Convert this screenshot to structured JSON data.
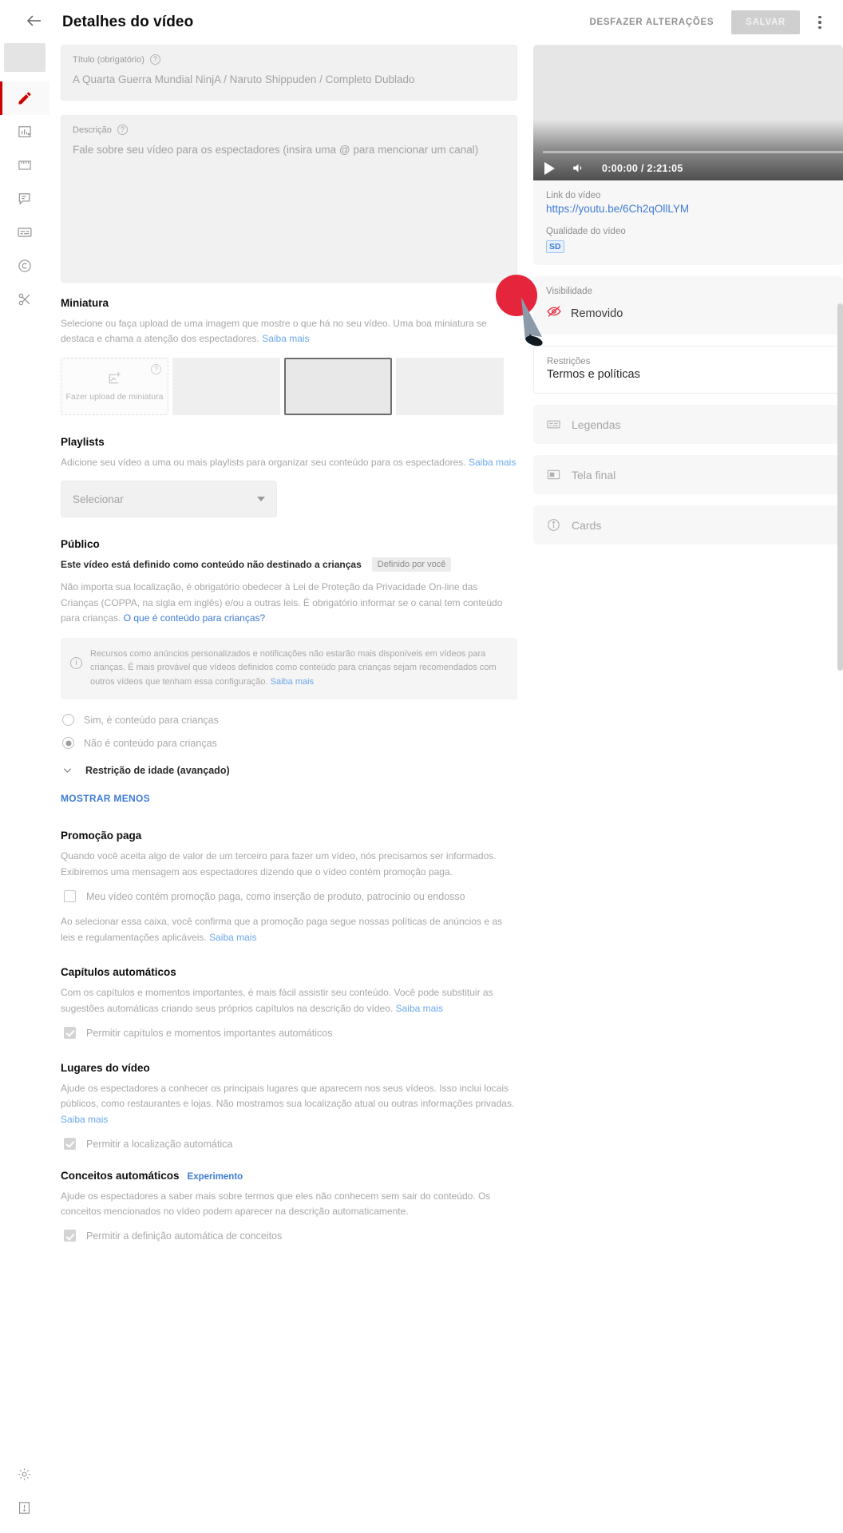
{
  "header": {
    "back_icon": "arrow-left-icon",
    "title": "Detalhes do vídeo",
    "undo_label": "DESFAZER ALTERAÇÕES",
    "save_label": "SALVAR",
    "menu_icon": "kebab-menu-icon"
  },
  "sidebar": {
    "items": [
      {
        "icon": "pencil-icon",
        "name": "details",
        "active": true
      },
      {
        "icon": "analytics-bar-chart-icon",
        "name": "analytics",
        "active": false
      },
      {
        "icon": "filmstrip-editor-icon",
        "name": "editor",
        "active": false
      },
      {
        "icon": "comment-icon",
        "name": "comments",
        "active": false
      },
      {
        "icon": "subtitles-icon",
        "name": "subtitles",
        "active": false
      },
      {
        "icon": "copyright-icon",
        "name": "copyright",
        "active": false
      },
      {
        "icon": "scissors-icon",
        "name": "trim",
        "active": false
      }
    ],
    "bottom_items": [
      {
        "icon": "gear-icon",
        "name": "settings"
      },
      {
        "icon": "feedback-icon",
        "name": "send-feedback"
      }
    ]
  },
  "main": {
    "title_field": {
      "label": "Título (obrigatório)",
      "help": "?",
      "value": "A Quarta Guerra Mundial NinjA / Naruto Shippuden / Completo Dublado"
    },
    "description_field": {
      "label": "Descrição",
      "help": "?",
      "placeholder": "Fale sobre seu vídeo para os espectadores (insira uma @ para mencionar um canal)"
    },
    "thumbnail": {
      "heading": "Miniatura",
      "description": "Selecione ou faça upload de uma imagem que mostre o que há no seu vídeo. Uma boa miniatura se destaca e chama a atenção dos espectadores.",
      "learn_more": "Saiba mais",
      "upload_label": "Fazer upload de miniatura",
      "upload_icon": "image-upload-icon",
      "help": "?",
      "options_count": 3,
      "selected_index": 2
    },
    "playlists": {
      "heading": "Playlists",
      "description": "Adicione seu vídeo a uma ou mais playlists para organizar seu conteúdo para os espectadores.",
      "learn_more": "Saiba mais",
      "select_value": "Selecionar",
      "caret_icon": "chevron-down-icon"
    },
    "audience": {
      "heading": "Público",
      "status_text": "Este vídeo está definido como conteúdo não destinado a crianças",
      "status_chip": "Definido por você",
      "legal_text": "Não importa sua localização, é obrigatório obedecer à Lei de Proteção da Privacidade On-line das Crianças (COPPA, na sigla em inglês) e/ou a outras leis. É obrigatório informar se o canal tem conteúdo para crianças.",
      "legal_link": "O que é conteúdo para crianças?",
      "info_icon": "info-icon",
      "info_text": "Recursos como anúncios personalizados e notificações não estarão mais disponíveis em vídeos para crianças. É mais provável que vídeos definidos como conteúdo para crianças sejam recomendados com outros vídeos que tenham essa configuração.",
      "info_link": "Saiba mais",
      "radio_yes": "Sim, é conteúdo para crianças",
      "radio_no": "Não é conteúdo para crianças",
      "selected": "no"
    },
    "age_restriction": {
      "label": "Restrição de idade (avançado)",
      "chevron_icon": "chevron-down-icon"
    },
    "show_less": "MOSTRAR MENOS",
    "paid_promotion": {
      "heading": "Promoção paga",
      "description": "Quando você aceita algo de valor de um terceiro para fazer um vídeo, nós precisamos ser informados. Exibiremos uma mensagem aos espectadores dizendo que o vídeo contém promoção paga.",
      "checkbox_label": "Meu vídeo contém promoção paga, como inserção de produto, patrocínio ou endosso",
      "checked": false,
      "footnote": "Ao selecionar essa caixa, você confirma que a promoção paga segue nossas políticas de anúncios e as leis e regulamentações aplicáveis.",
      "footnote_link": "Saiba mais"
    },
    "auto_chapters": {
      "heading": "Capítulos automáticos",
      "description": "Com os capítulos e momentos importantes, é mais fácil assistir seu conteúdo. Você pode substituir as sugestões automáticas criando seus próprios capítulos na descrição do vídeo.",
      "learn_more": "Saiba mais",
      "checkbox_label": "Permitir capítulos e momentos importantes automáticos",
      "checked": true
    },
    "video_places": {
      "heading": "Lugares do vídeo",
      "description": "Ajude os espectadores a conhecer os principais lugares que aparecem nos seus vídeos. Isso inclui locais públicos, como restaurantes e lojas. Não mostramos sua localização atual ou outras informações privadas.",
      "learn_more": "Saiba mais",
      "checkbox_label": "Permitir a localização automática",
      "checked": true
    },
    "auto_concepts": {
      "heading": "Conceitos automáticos",
      "badge": "Experimento",
      "description": "Ajude os espectadores a saber mais sobre termos que eles não conhecem sem sair do conteúdo. Os conceitos mencionados no vídeo podem aparecer na descrição automaticamente.",
      "checkbox_label": "Permitir a definição automática de conceitos",
      "checked": true
    }
  },
  "right_panel": {
    "player": {
      "play_icon": "play-icon",
      "volume_icon": "volume-icon",
      "timecode": "0:00:00 / 2:21:05",
      "current_time": "0:00:00",
      "duration": "2:21:05"
    },
    "video_link": {
      "label": "Link do vídeo",
      "url": "https://youtu.be/6Ch2qOllLYM"
    },
    "video_quality": {
      "label": "Qualidade do vídeo",
      "badge": "SD"
    },
    "visibility": {
      "label": "Visibilidade",
      "value": "Removido",
      "icon": "removed-eye-slash-icon"
    },
    "restrictions": {
      "label": "Restrições",
      "value": "Termos e políticas"
    },
    "side_items": [
      {
        "icon": "subtitles-icon",
        "label": "Legendas"
      },
      {
        "icon": "end-screen-icon",
        "label": "Tela final"
      },
      {
        "icon": "cards-info-icon",
        "label": "Cards"
      }
    ]
  },
  "annotation": {
    "cursor_icon": "cursor-pointer-annotation",
    "accent_color": "#e4253c"
  }
}
